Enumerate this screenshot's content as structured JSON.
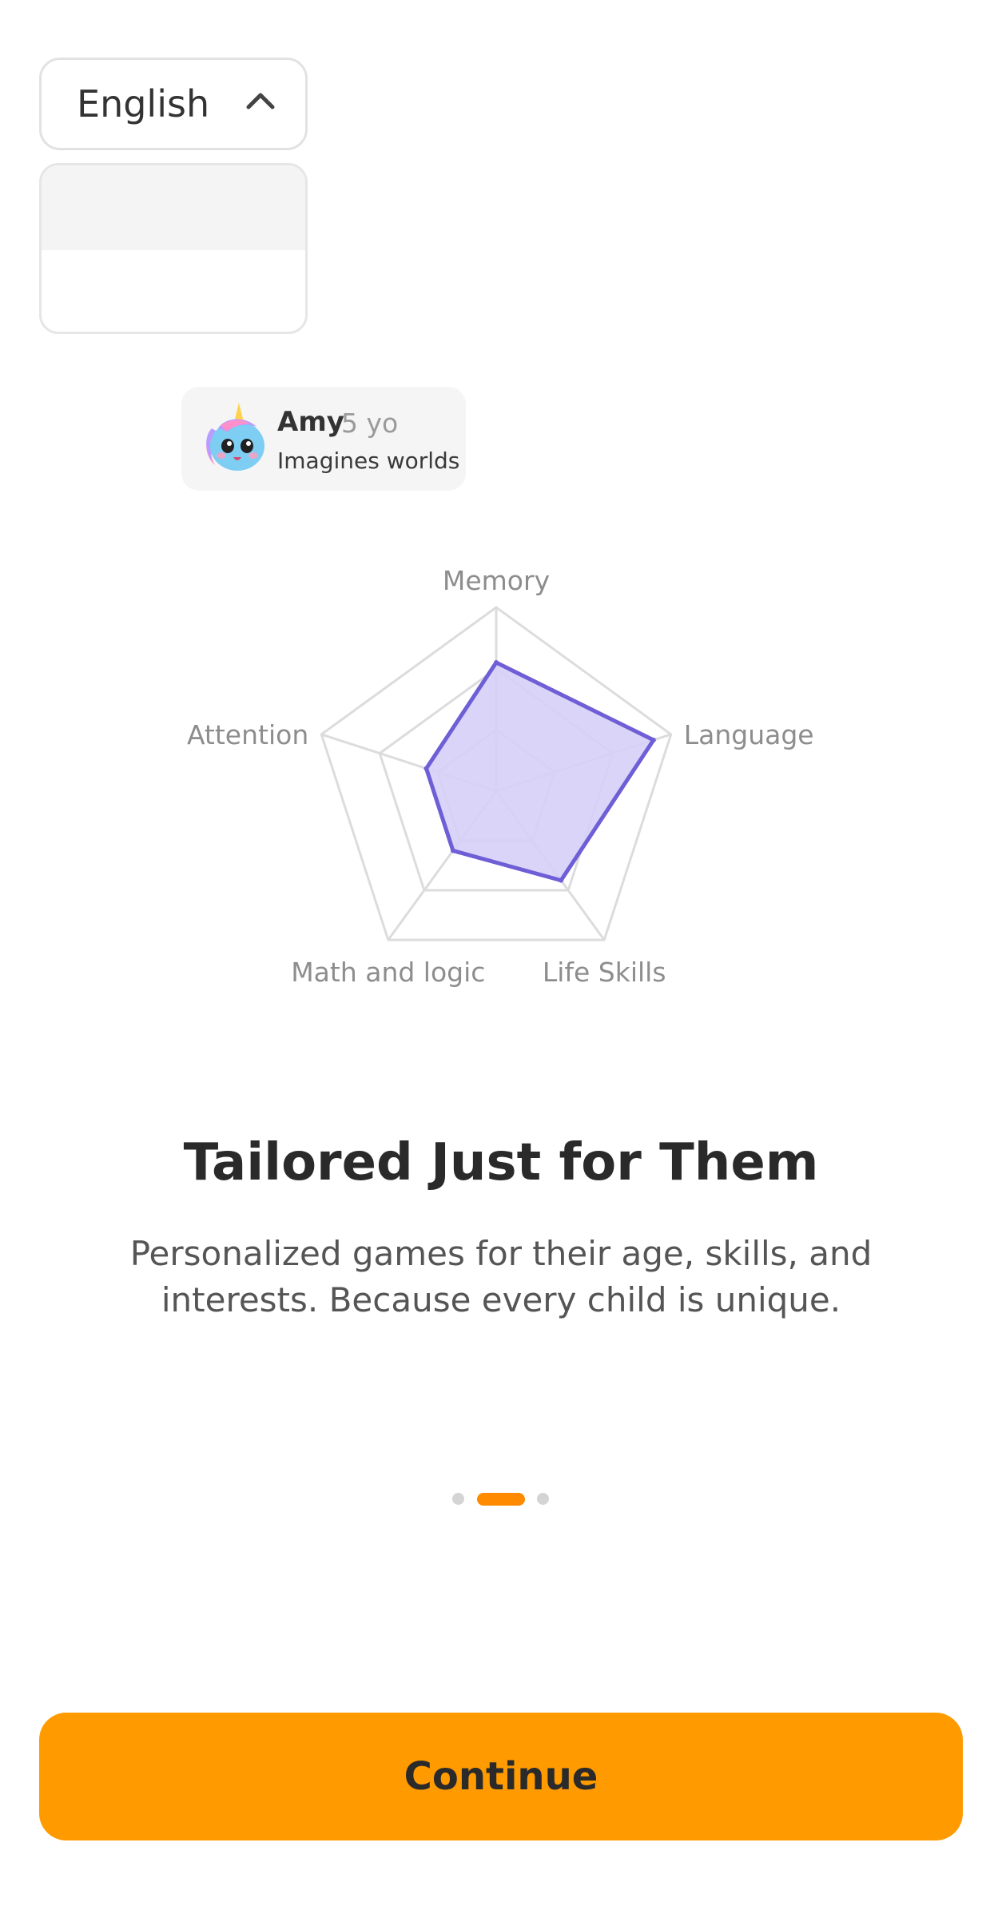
{
  "language_selector": {
    "selected": "English",
    "options": [
      "",
      ""
    ]
  },
  "profile": {
    "name": "Amy",
    "age": "5 yo",
    "trait": "Imagines worlds",
    "avatar_icon": "unicorn-avatar-icon"
  },
  "chart_data": {
    "type": "radar",
    "axes": [
      "Memory",
      "Language",
      "Life Skills",
      "Math and logic",
      "Attention"
    ],
    "values": [
      0.7,
      0.9,
      0.6,
      0.4,
      0.4
    ],
    "range": [
      0,
      1
    ],
    "rings": 3,
    "fill_color": "#d5cff7",
    "stroke_color": "#6e5fd6",
    "grid_color": "#dcdcdc"
  },
  "onboarding": {
    "title": "Tailored Just for Them",
    "subtitle": "Personalized games for their age, skills, and interests. Because every child is unique.",
    "page_count": 3,
    "current_page": 2
  },
  "continue_label": "Continue",
  "colors": {
    "accent": "#ff9a00",
    "page_indicator_active": "#ff8a00"
  }
}
